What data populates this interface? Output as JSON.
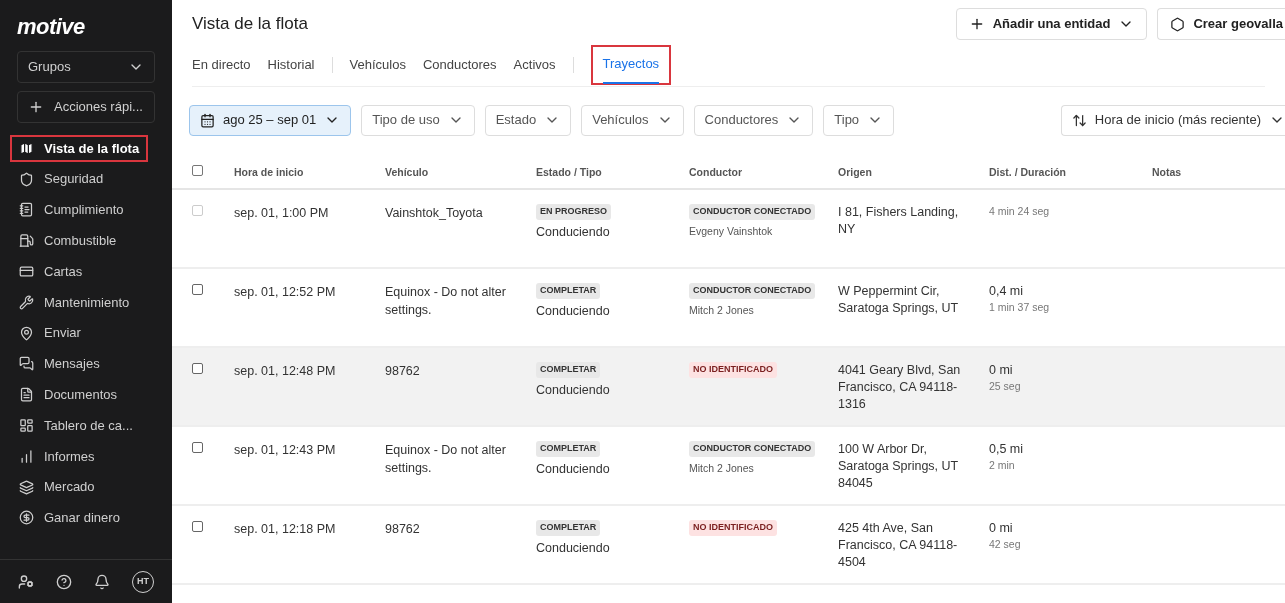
{
  "sidebar": {
    "logo": "motive",
    "groups_select": "Grupos",
    "quick_actions": "Acciones rápi...",
    "items": [
      {
        "label": "Vista de la flota",
        "selected": true,
        "annotated": true
      },
      {
        "label": "Seguridad",
        "selected": false,
        "annotated": false
      },
      {
        "label": "Cumplimiento",
        "selected": false,
        "annotated": false
      },
      {
        "label": "Combustible",
        "selected": false,
        "annotated": false
      },
      {
        "label": "Cartas",
        "selected": false,
        "annotated": false
      },
      {
        "label": "Mantenimiento",
        "selected": false,
        "annotated": false
      },
      {
        "label": "Enviar",
        "selected": false,
        "annotated": false
      },
      {
        "label": "Mensajes",
        "selected": false,
        "annotated": false
      },
      {
        "label": "Documentos",
        "selected": false,
        "annotated": false
      },
      {
        "label": "Tablero de ca...",
        "selected": false,
        "annotated": false
      },
      {
        "label": "Informes",
        "selected": false,
        "annotated": false
      },
      {
        "label": "Mercado",
        "selected": false,
        "annotated": false
      },
      {
        "label": "Ganar dinero",
        "selected": false,
        "annotated": false
      }
    ],
    "avatar": "HT"
  },
  "header": {
    "title": "Vista de la flota",
    "add_entity": "Añadir una entidad",
    "create_geofence": "Crear geovalla"
  },
  "tab_groups": [
    {
      "tabs": [
        {
          "label": "En directo",
          "selected": false,
          "annotated": false
        },
        {
          "label": "Historial",
          "selected": false,
          "annotated": false
        }
      ]
    },
    {
      "tabs": [
        {
          "label": "Vehículos",
          "selected": false,
          "annotated": false
        },
        {
          "label": "Conductores",
          "selected": false,
          "annotated": false
        },
        {
          "label": "Activos",
          "selected": false,
          "annotated": false
        }
      ]
    },
    {
      "tabs": [
        {
          "label": "Trayectos",
          "selected": true,
          "annotated": true
        }
      ]
    }
  ],
  "filters": [
    {
      "label": "ago 25 – sep 01",
      "kind": "date",
      "active": true
    },
    {
      "label": "Tipo de uso",
      "kind": "dropdown",
      "active": false
    },
    {
      "label": "Estado",
      "kind": "dropdown",
      "active": false
    },
    {
      "label": "Vehículos",
      "kind": "dropdown",
      "active": false
    },
    {
      "label": "Conductores",
      "kind": "dropdown",
      "active": false
    },
    {
      "label": "Tipo",
      "kind": "dropdown",
      "active": false
    }
  ],
  "sort": "Hora de inicio (más reciente)",
  "table": {
    "select_all": {
      "checked": false
    },
    "columns": [
      "Hora de inicio",
      "Vehículo",
      "Estado / Tipo",
      "Conductor",
      "Origen",
      "Dist. / Duración",
      "Notas"
    ],
    "rows": [
      {
        "checked": false,
        "disabled": true,
        "highlighted": false,
        "start": "sep. 01, 1:00 PM",
        "vehicle": "Vainshtok_Toyota",
        "status": "EN PROGRESO",
        "type": "Conduciendo",
        "driver_badge": {
          "text": "CONDUCTOR CONECTADO",
          "kind": "connected"
        },
        "driver": "Evgeny Vainshtok",
        "origin": "I 81, Fishers Landing, NY",
        "duration": "4 min 24 seg"
      },
      {
        "checked": false,
        "disabled": false,
        "highlighted": false,
        "start": "sep. 01, 12:52 PM",
        "vehicle": "Equinox - Do not alter settings.",
        "status": "COMPLETAR",
        "type": "Conduciendo",
        "driver_badge": {
          "text": "CONDUCTOR CONECTADO",
          "kind": "connected"
        },
        "driver": "Mitch 2 Jones",
        "origin": "W Peppermint Cir, Saratoga Springs, UT",
        "distance": "0,4 mi",
        "duration": "1 min 37 seg"
      },
      {
        "checked": false,
        "disabled": false,
        "highlighted": true,
        "start": "sep. 01, 12:48 PM",
        "vehicle": "98762",
        "status": "COMPLETAR",
        "type": "Conduciendo",
        "driver_badge": {
          "text": "NO IDENTIFICADO",
          "kind": "unidentified"
        },
        "origin": "4041 Geary Blvd, San Francisco, CA 94118-1316",
        "distance": "0 mi",
        "duration": "25 seg"
      },
      {
        "checked": false,
        "disabled": false,
        "highlighted": false,
        "start": "sep. 01, 12:43 PM",
        "vehicle": "Equinox - Do not alter settings.",
        "status": "COMPLETAR",
        "type": "Conduciendo",
        "driver_badge": {
          "text": "CONDUCTOR CONECTADO",
          "kind": "connected"
        },
        "driver": "Mitch 2 Jones",
        "origin": "100 W Arbor Dr, Saratoga Springs, UT 84045",
        "distance": "0,5 mi",
        "duration": "2 min"
      },
      {
        "checked": false,
        "disabled": false,
        "highlighted": false,
        "start": "sep. 01, 12:18 PM",
        "vehicle": "98762",
        "status": "COMPLETAR",
        "type": "Conduciendo",
        "driver_badge": {
          "text": "NO IDENTIFICADO",
          "kind": "unidentified"
        },
        "origin": "425 4th Ave, San Francisco, CA 94118-4504",
        "distance": "0 mi",
        "duration": "42 seg"
      }
    ]
  }
}
